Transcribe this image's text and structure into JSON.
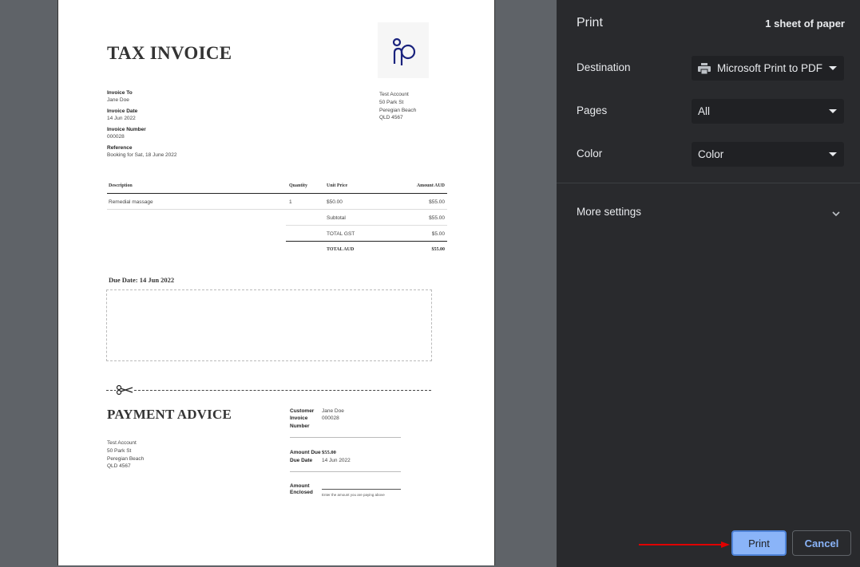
{
  "invoice": {
    "title": "TAX INVOICE",
    "invoice_to_label": "Invoice To",
    "invoice_to_value": "Jane Doe",
    "invoice_date_label": "Invoice Date",
    "invoice_date_value": "14 Jun 2022",
    "invoice_number_label": "Invoice Number",
    "invoice_number_value": "000028",
    "reference_label": "Reference",
    "reference_value": "Booking for Sat, 18 June 2022",
    "from_address": [
      "Test Account",
      "50 Park St",
      "Peregian Beach",
      "QLD 4567"
    ],
    "table": {
      "headers": {
        "description": "Description",
        "quantity": "Quantity",
        "unit_price": "Unit Price",
        "amount": "Amount AUD"
      },
      "rows": [
        {
          "description": "Remedial massage",
          "quantity": "1",
          "unit_price": "$50.00",
          "amount": "$55.00"
        }
      ],
      "subtotal_label": "Subtotal",
      "subtotal_value": "$55.00",
      "gst_label": "TOTAL GST",
      "gst_value": "$5.00",
      "total_label": "TOTAL AUD",
      "total_value": "$55.00"
    },
    "due_date": "Due Date: 14 Jun 2022"
  },
  "payment_advice": {
    "title": "PAYMENT ADVICE",
    "address": [
      "Test Account",
      "50 Park St",
      "Peregian Beach",
      "QLD 4567"
    ],
    "customer_label": "Customer",
    "customer_value": "Jane Doe",
    "invoice_number_label_1": "Invoice",
    "invoice_number_label_2": "Number",
    "invoice_number_value": "000028",
    "amount_due_label": "Amount Due",
    "amount_due_value": "$55.00",
    "due_date_label": "Due Date",
    "due_date_value": "14 Jun 2022",
    "amount_enclosed_label_1": "Amount",
    "amount_enclosed_label_2": "Enclosed",
    "amount_enclosed_hint": "Enter the amount you are paying above"
  },
  "print_panel": {
    "title": "Print",
    "sheets": "1 sheet of paper",
    "destination_label": "Destination",
    "destination_value": "Microsoft Print to PDF",
    "pages_label": "Pages",
    "pages_value": "All",
    "color_label": "Color",
    "color_value": "Color",
    "more_settings": "More settings",
    "print_button": "Print",
    "cancel_button": "Cancel"
  },
  "colors": {
    "panel_bg": "#292a2d",
    "accent": "#8ab4f8",
    "arrow": "#e00000",
    "logo": "#1a237e"
  },
  "icons": [
    "printer-icon",
    "chevron-down-icon",
    "scissors-icon",
    "logo-icon"
  ]
}
